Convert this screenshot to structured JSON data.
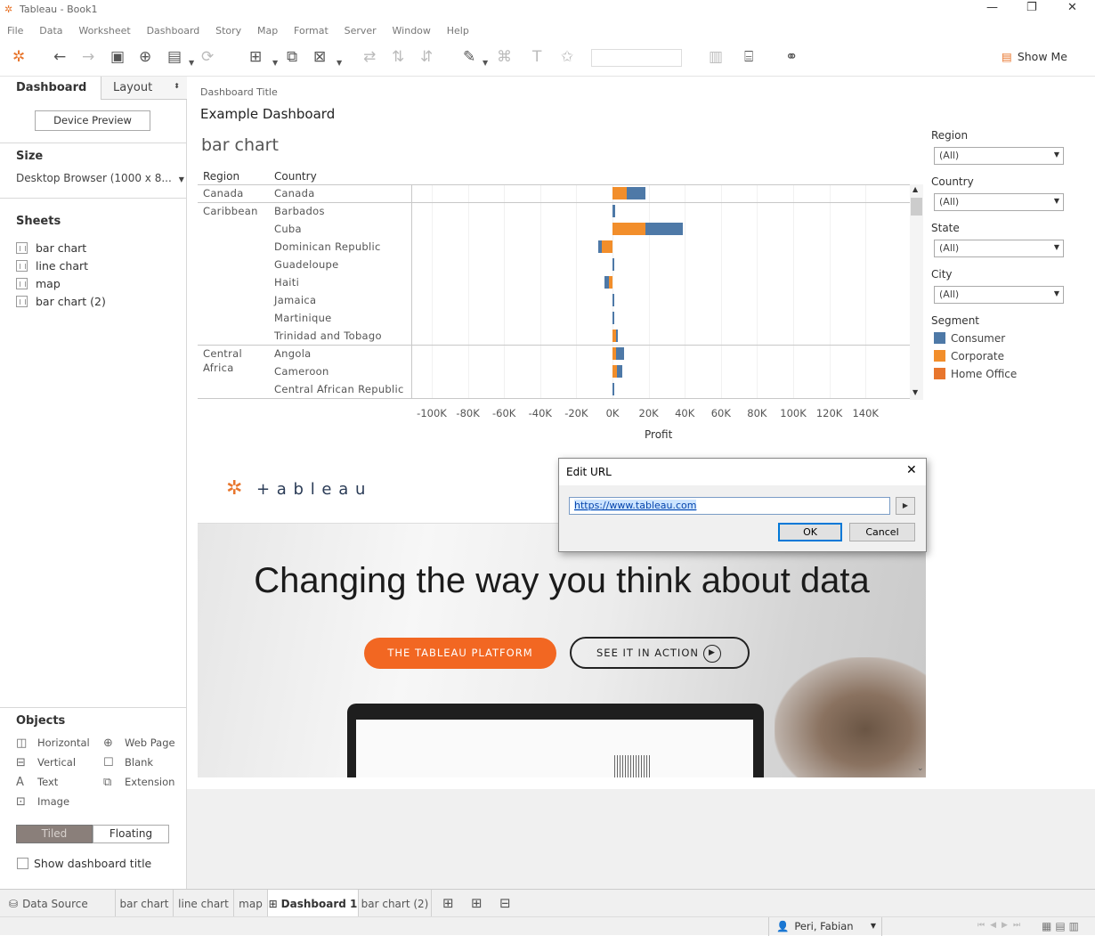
{
  "window": {
    "title": "Tableau - Book1"
  },
  "menu": [
    "File",
    "Data",
    "Worksheet",
    "Dashboard",
    "Story",
    "Map",
    "Format",
    "Server",
    "Window",
    "Help"
  ],
  "toolbar": {
    "show_me": "Show Me"
  },
  "leftpane": {
    "tab_dashboard": "Dashboard",
    "tab_layout": "Layout",
    "device_preview": "Device Preview",
    "size_title": "Size",
    "size_value": "Desktop Browser (1000 x 8...",
    "sheets_title": "Sheets",
    "sheets": [
      "bar chart",
      "line chart",
      "map",
      "bar chart (2)"
    ],
    "objects_title": "Objects",
    "objects": [
      {
        "label": "Horizontal",
        "icon": "horizontal-icon"
      },
      {
        "label": "Web Page",
        "icon": "globe-icon"
      },
      {
        "label": "Vertical",
        "icon": "vertical-icon"
      },
      {
        "label": "Blank",
        "icon": "blank-icon"
      },
      {
        "label": "Text",
        "icon": "text-icon"
      },
      {
        "label": "Extension",
        "icon": "extension-icon"
      },
      {
        "label": "Image",
        "icon": "image-icon"
      }
    ],
    "tiled": "Tiled",
    "floating": "Floating",
    "show_title": "Show dashboard title"
  },
  "dashboard": {
    "title_caption": "Dashboard Title",
    "title": "Example Dashboard",
    "sheet_title": "bar chart",
    "col_region": "Region",
    "col_country": "Country"
  },
  "chart_data": {
    "type": "bar",
    "orientation": "horizontal",
    "stacked": true,
    "xlabel": "Profit",
    "xticks": [
      "-100K",
      "-80K",
      "-60K",
      "-40K",
      "-20K",
      "0K",
      "20K",
      "40K",
      "60K",
      "80K",
      "100K",
      "120K",
      "140K"
    ],
    "xlim": [
      -110000,
      150000
    ],
    "regions": [
      {
        "name": "Canada",
        "label_lines": [
          "Canada"
        ]
      },
      {
        "name": "Caribbean",
        "label_lines": [
          "Caribbean"
        ]
      },
      {
        "name": "Central Africa",
        "label_lines": [
          "Central",
          "Africa"
        ]
      }
    ],
    "rows": [
      {
        "region": "Canada",
        "country": "Canada",
        "corporate": 8000,
        "consumer": 10000,
        "home_office": 0
      },
      {
        "region": "Caribbean",
        "country": "Barbados",
        "corporate": 0,
        "consumer": 1500,
        "home_office": 0
      },
      {
        "region": "Caribbean",
        "country": "Cuba",
        "corporate": 18000,
        "consumer": 21000,
        "home_office": 0
      },
      {
        "region": "Caribbean",
        "country": "Dominican Republic",
        "corporate": -6000,
        "consumer": -2000,
        "home_office": 0
      },
      {
        "region": "Caribbean",
        "country": "Guadeloupe",
        "corporate": 0,
        "consumer": 800,
        "home_office": 0
      },
      {
        "region": "Caribbean",
        "country": "Haiti",
        "corporate": -2000,
        "consumer": -2500,
        "home_office": 0
      },
      {
        "region": "Caribbean",
        "country": "Jamaica",
        "corporate": 0,
        "consumer": 1000,
        "home_office": 0
      },
      {
        "region": "Caribbean",
        "country": "Martinique",
        "corporate": 0,
        "consumer": 700,
        "home_office": 0
      },
      {
        "region": "Caribbean",
        "country": "Trinidad and Tobago",
        "corporate": 2000,
        "consumer": 500,
        "home_office": 0
      },
      {
        "region": "Central Africa",
        "country": "Angola",
        "corporate": 2000,
        "consumer": 4500,
        "home_office": 0
      },
      {
        "region": "Central Africa",
        "country": "Cameroon",
        "corporate": 2500,
        "consumer": 3000,
        "home_office": 0
      },
      {
        "region": "Central Africa",
        "country": "Central African Republic",
        "corporate": 0,
        "consumer": 400,
        "home_office": 0
      }
    ],
    "colors": {
      "consumer": "#4e79a7",
      "corporate": "#f28e2b",
      "home_office": "#e8762d"
    }
  },
  "filters": [
    {
      "label": "Region",
      "value": "(All)"
    },
    {
      "label": "Country",
      "value": "(All)"
    },
    {
      "label": "State",
      "value": "(All)"
    },
    {
      "label": "City",
      "value": "(All)"
    }
  ],
  "legend": {
    "title": "Segment",
    "items": [
      {
        "label": "Consumer",
        "color": "#4e79a7"
      },
      {
        "label": "Corporate",
        "color": "#f28e2b"
      },
      {
        "label": "Home Office",
        "color": "#e8762d"
      }
    ]
  },
  "webpage": {
    "logo_text": "+ a b l e a u",
    "headline": "Changing the way you think about data",
    "btn_platform": "THE TABLEAU PLATFORM",
    "btn_action": "SEE IT IN ACTION",
    "accent": "#f26722"
  },
  "dialog": {
    "title": "Edit URL",
    "url": "https://www.tableau.com",
    "ok": "OK",
    "cancel": "Cancel"
  },
  "bottomtabs": [
    "Data Source",
    "bar chart",
    "line chart",
    "map",
    "Dashboard 1",
    "bar chart (2)"
  ],
  "status": {
    "user": "Peri, Fabian"
  }
}
